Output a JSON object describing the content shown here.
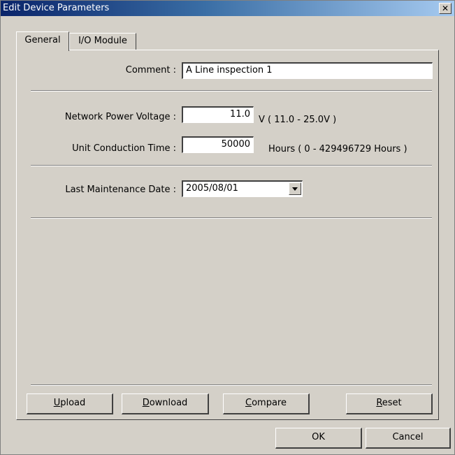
{
  "window": {
    "title": "Edit Device Parameters",
    "close_glyph": "✕"
  },
  "tabs": [
    {
      "label": "General",
      "active": true
    },
    {
      "label": "I/O Module",
      "active": false
    }
  ],
  "general": {
    "comment": {
      "label": "Comment :",
      "value": "A Line inspection 1"
    },
    "network_power_voltage": {
      "label": "Network Power Voltage :",
      "value": "11.0",
      "unit_range": "V ( 11.0 - 25.0V )"
    },
    "unit_conduction_time": {
      "label": "Unit Conduction Time :",
      "value": "50000",
      "unit_range": "Hours ( 0 - 429496729 Hours )"
    },
    "last_maintenance_date": {
      "label": "Last Maintenance Date :",
      "value": "2005/08/01"
    }
  },
  "actions": {
    "upload": {
      "accel": "U",
      "rest": "pload"
    },
    "download": {
      "accel": "D",
      "rest": "ownload"
    },
    "compare": {
      "accel": "C",
      "rest": "ompare"
    },
    "reset": {
      "accel": "R",
      "rest": "eset"
    }
  },
  "dialog_buttons": {
    "ok": "OK",
    "cancel": "Cancel"
  },
  "colors": {
    "face": "#d4d0c8",
    "title_start": "#0a246a",
    "title_end": "#a6caf0"
  }
}
